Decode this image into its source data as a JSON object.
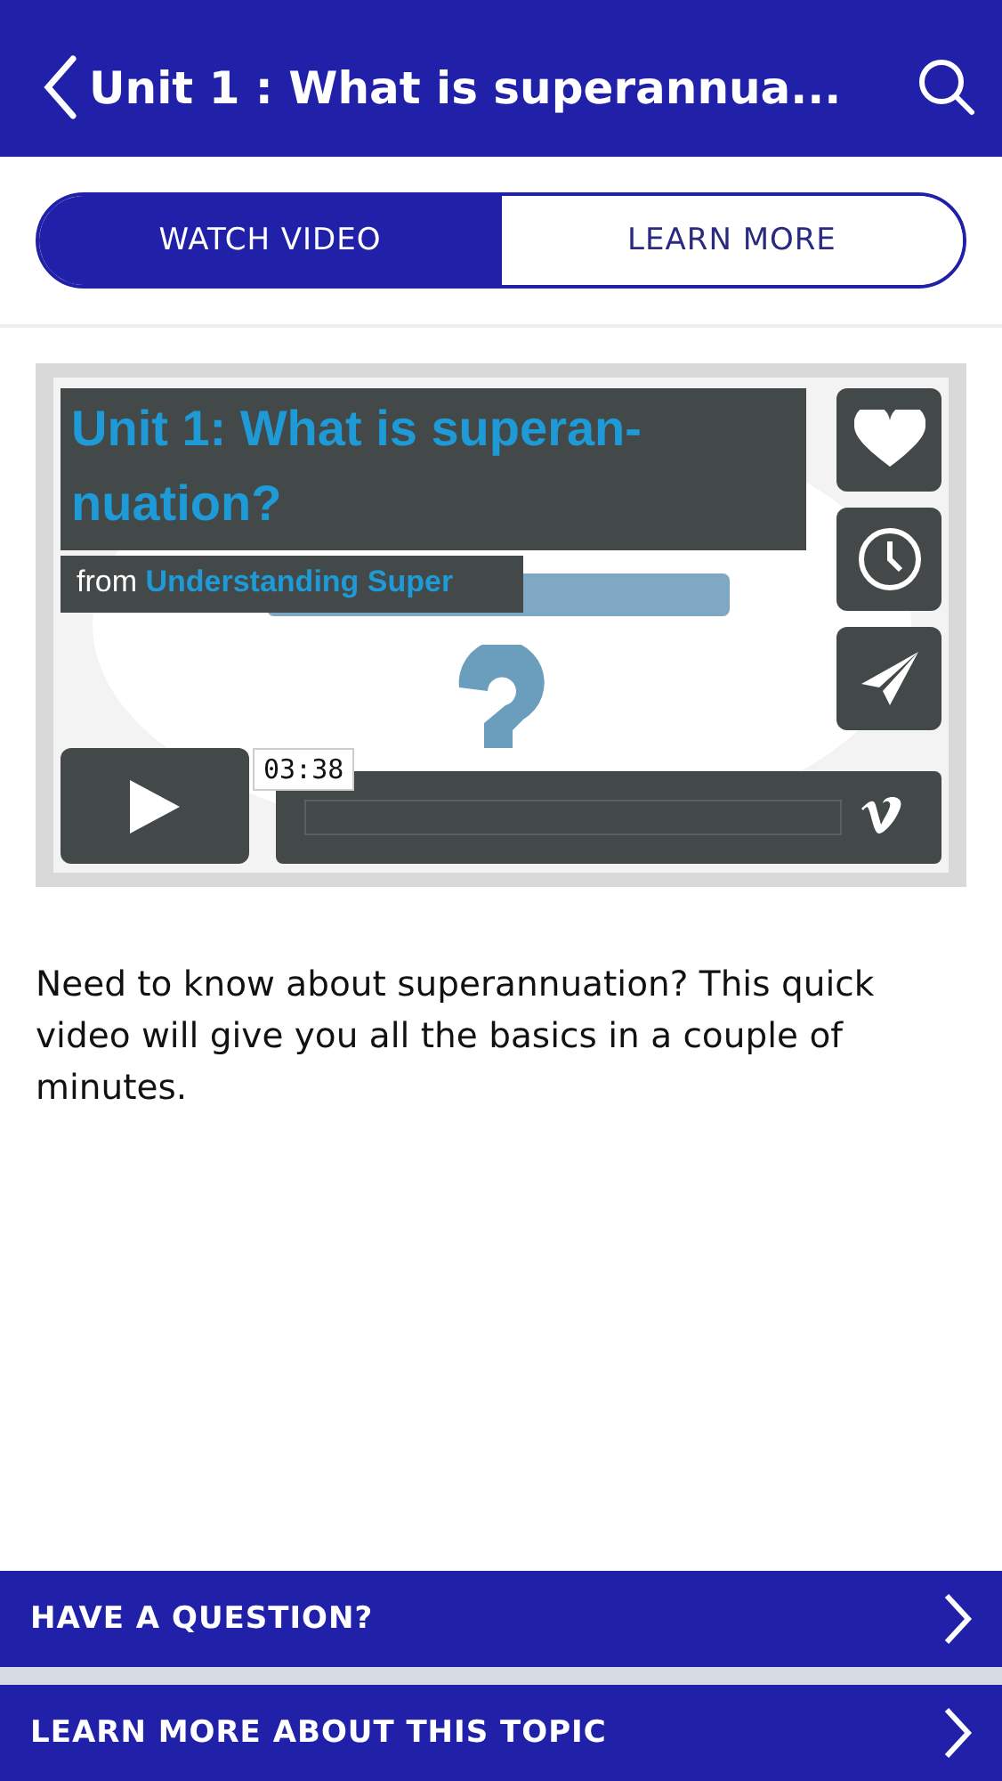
{
  "header": {
    "title": "Unit 1 : What is superannua..."
  },
  "tabs": [
    {
      "label": "WATCH VIDEO",
      "selected": true
    },
    {
      "label": "LEARN MORE",
      "selected": false
    }
  ],
  "video": {
    "kind": "picture",
    "title_lines": [
      "Unit 1: What is superan-",
      "nuation?"
    ],
    "from_label": "from",
    "channel": "Understanding Super",
    "time": "03:38",
    "level": 0
  },
  "description": "Need to know about superannuation? This quick video will give you all the basics in a couple of minutes.",
  "actions": [
    {
      "label": "HAVE A QUESTION?"
    },
    {
      "label": "LEARN MORE ABOUT THIS TOPIC"
    }
  ]
}
